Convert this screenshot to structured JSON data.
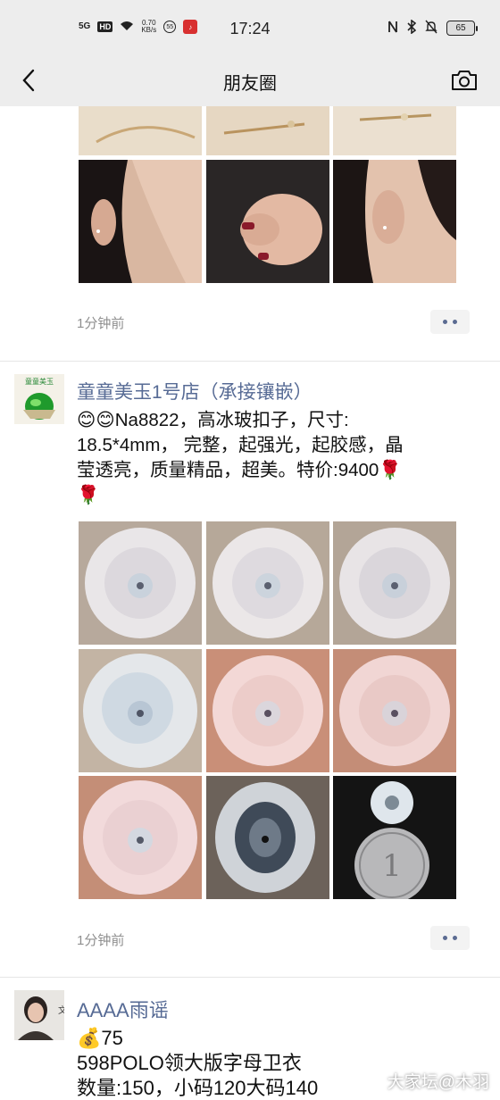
{
  "status_bar": {
    "signal": "5G",
    "hd": "HD",
    "net_speed_value": "0.70",
    "net_speed_unit": "KB/s",
    "badge": "55",
    "time": "17:24",
    "battery": "65"
  },
  "nav": {
    "title": "朋友圈"
  },
  "posts": [
    {
      "timestamp": "1分钟前"
    },
    {
      "author": "童童美玉1号店（承接镶嵌）",
      "avatar_text": "童童美玉",
      "text_line1": "😊😊Na8822，高冰玻扣子，尺寸:",
      "text_line2": "18.5*4mm， 完整，起强光，起胶感，晶",
      "text_line3": "莹透亮，质量精品，超美。特价:9400🌹",
      "text_line4": "🌹",
      "timestamp": "1分钟前"
    },
    {
      "author": "AAAA雨谣",
      "line1": "💰75",
      "line2": "598POLO领大版字母卫衣",
      "line3": "数量:150，小码120大码140"
    }
  ],
  "watermark": "大家坛@木羽",
  "icons": {
    "back": "chevron-left-icon",
    "camera": "camera-icon",
    "more": "more-dots-icon"
  }
}
